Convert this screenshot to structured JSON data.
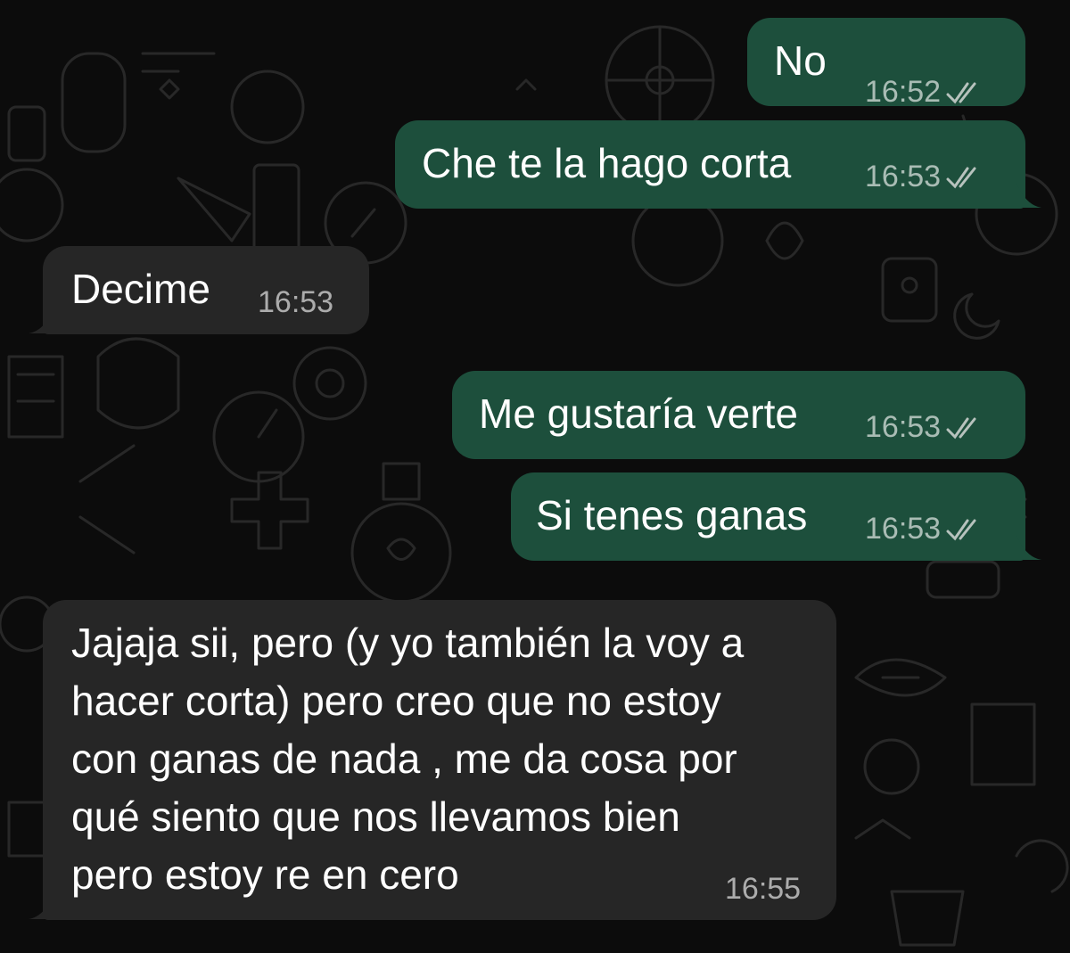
{
  "messages": [
    {
      "direction": "out",
      "text": "No",
      "time": "16:52",
      "status": "read"
    },
    {
      "direction": "out",
      "text": "Che te la hago corta",
      "time": "16:53",
      "status": "read"
    },
    {
      "direction": "in",
      "text": "Decime",
      "time": "16:53"
    },
    {
      "direction": "out",
      "text": "Me gustaría verte",
      "time": "16:53",
      "status": "read"
    },
    {
      "direction": "out",
      "text": "Si tenes ganas",
      "time": "16:53",
      "status": "read"
    },
    {
      "direction": "in",
      "lines": [
        "Jajaja sii, pero (y yo también la voy a",
        "hacer corta) pero creo que no estoy",
        "con ganas de nada , me da cosa por",
        "qué siento que nos llevamos bien",
        "pero estoy re en cero"
      ],
      "time": "16:55"
    }
  ],
  "colors": {
    "outgoing_bubble": "#1d4f3c",
    "incoming_bubble": "#262626",
    "background": "#0c0c0c",
    "read_ticks": "#b7c2bd"
  },
  "icons": {
    "read_receipt": "double-check-icon",
    "wallpaper": "doodle-pattern"
  }
}
